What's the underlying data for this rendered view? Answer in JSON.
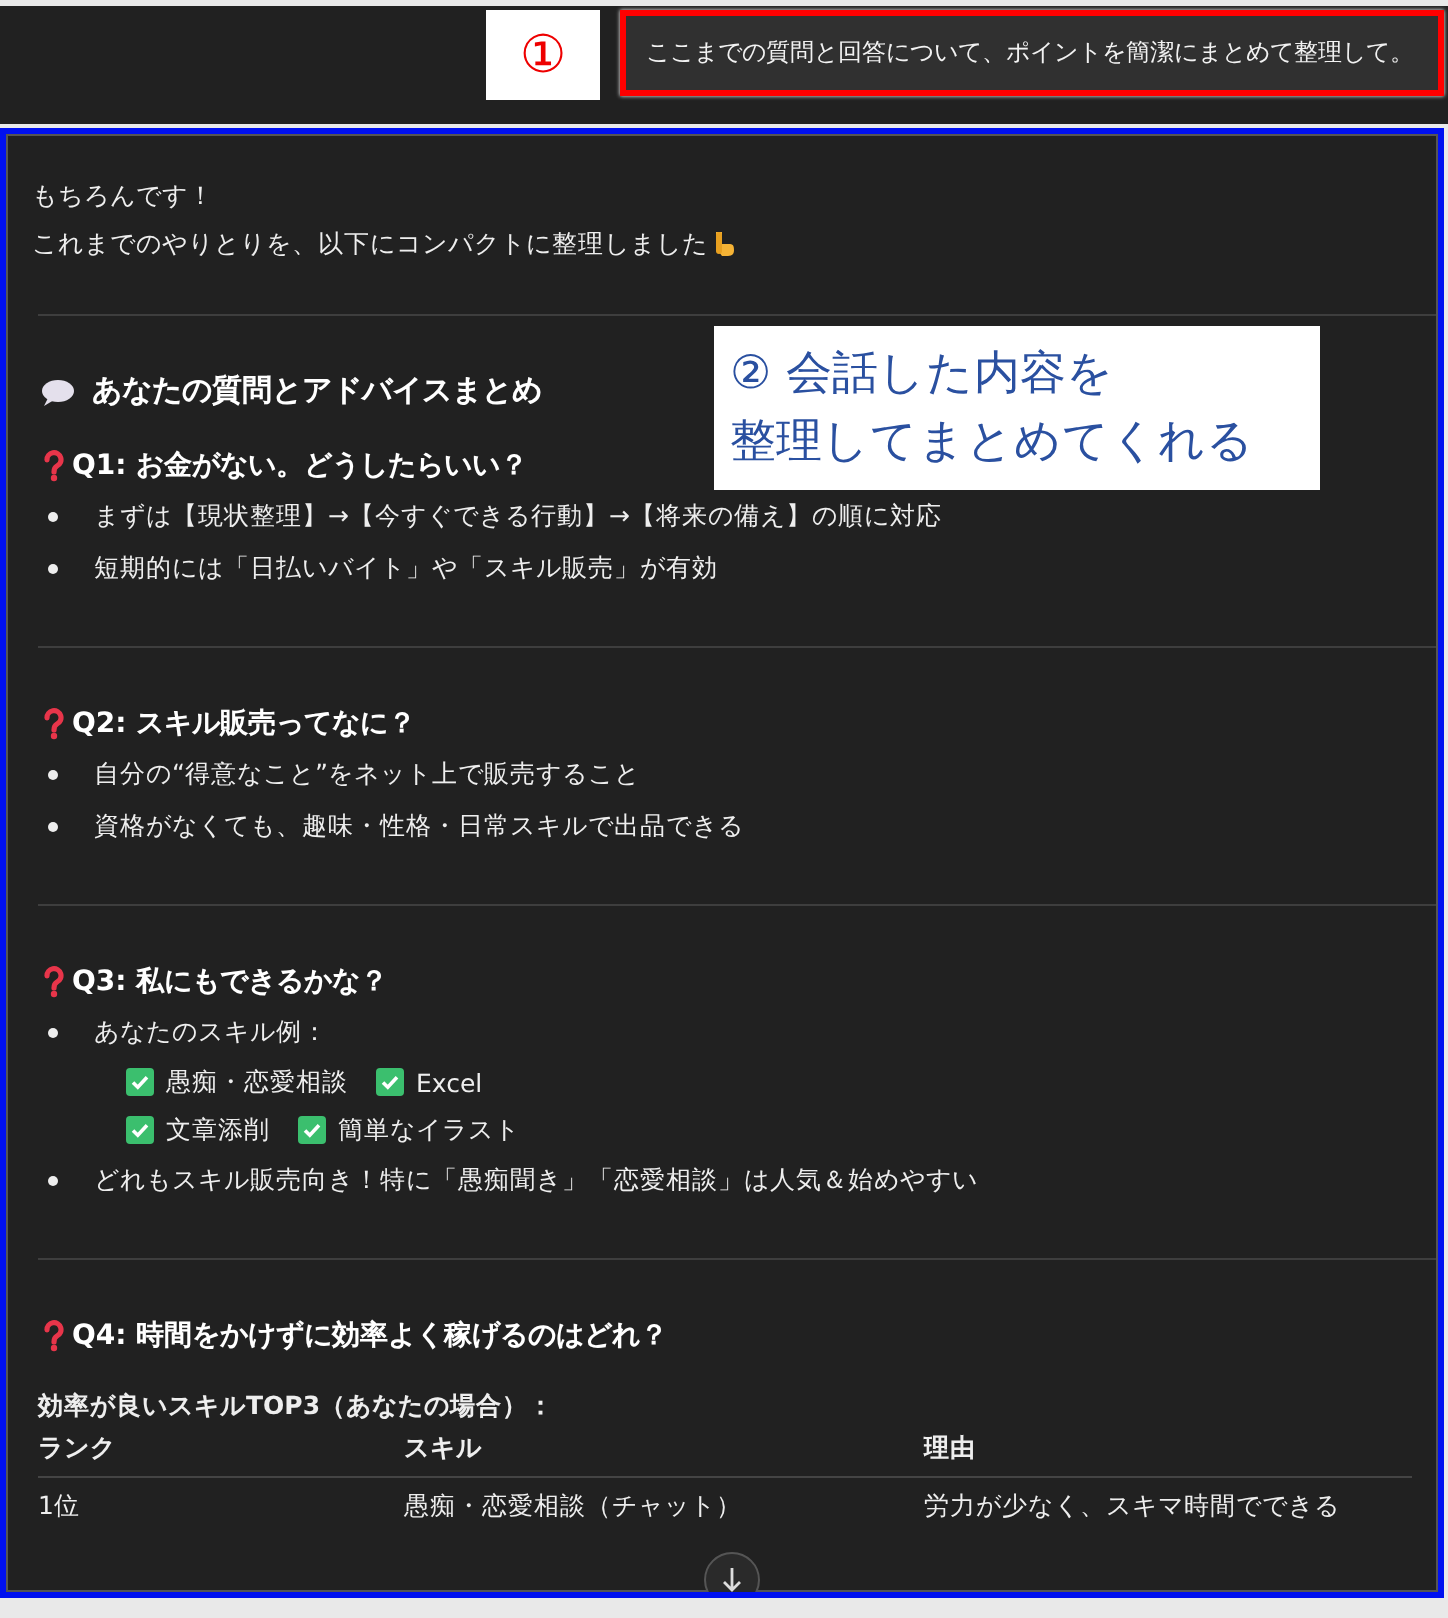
{
  "user_message": "ここまでの質問と回答について、ポイントを簡潔にまとめて整理して。",
  "callouts": [
    {
      "lines": [
        "①"
      ]
    },
    {
      "lines": [
        "② 会話した内容を",
        "整理してまとめてくれる"
      ]
    }
  ],
  "response": {
    "intro": [
      "もちろんです！",
      "これまでのやりとりを、以下にコンパクトに整理しました"
    ],
    "heading": "あなたの質問とアドバイスまとめ",
    "sections": [
      {
        "title": "Q1: お金がない。どうしたらいい？",
        "bullets": [
          {
            "text": "まずは【現状整理】→【今すぐできる行動】→【将来の備え】の順に対応"
          },
          {
            "text": "短期的には「日払いバイト」や「スキル販売」が有効"
          }
        ]
      },
      {
        "title": "Q2: スキル販売ってなに？",
        "bullets": [
          {
            "text": "自分の“得意なこと”をネット上で販売すること"
          },
          {
            "text": "資格がなくても、趣味・性格・日常スキルで出品できる"
          }
        ]
      },
      {
        "title": "Q3: 私にもできるかな？",
        "bullets": [
          {
            "text": "あなたのスキル例：",
            "checks": [
              [
                {
                  "label": "愚痴・恋愛相談",
                  "checked": true
                },
                {
                  "label": "Excel",
                  "checked": true
                }
              ],
              [
                {
                  "label": "文章添削",
                  "checked": true
                },
                {
                  "label": "簡単なイラスト",
                  "checked": true
                }
              ]
            ]
          },
          {
            "text": "どれもスキル販売向き！特に「愚痴聞き」「恋愛相談」は人気＆始めやすい"
          }
        ]
      },
      {
        "title": "Q4: 時間をかけずに効率よく稼げるのはどれ？",
        "subtitle": "効率が良いスキルTOP3（あなたの場合）：",
        "table": {
          "columns": [
            "ランク",
            "スキル",
            "理由"
          ],
          "rows": [
            [
              "1位",
              "愚痴・恋愛相談（チャット）",
              "労力が少なく、スキマ時間でできる"
            ]
          ]
        }
      }
    ]
  }
}
